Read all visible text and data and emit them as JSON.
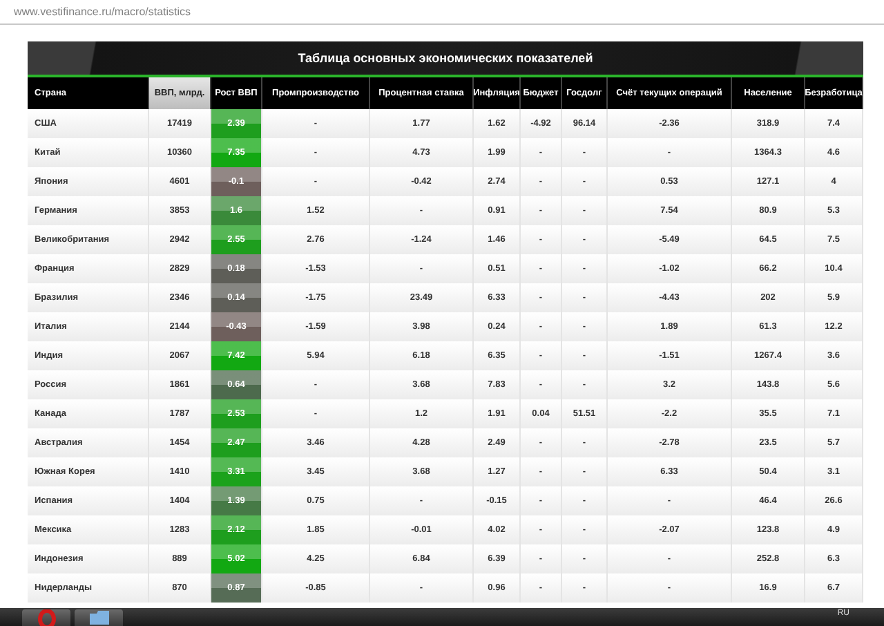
{
  "browser": {
    "url": "www.vestifinance.ru/macro/statistics"
  },
  "table": {
    "title": "Таблица основных экономических показателей",
    "columns": [
      {
        "label": "Страна",
        "selected": false
      },
      {
        "label": "ВВП, млрд.",
        "selected": true
      },
      {
        "label": "Рост ВВП",
        "selected": false
      },
      {
        "label": "Промпроизводство",
        "selected": false
      },
      {
        "label": "Процентная ставка",
        "selected": false
      },
      {
        "label": "Инфляция",
        "selected": false
      },
      {
        "label": "Бюджет",
        "selected": false
      },
      {
        "label": "Госдолг",
        "selected": false
      },
      {
        "label": "Счёт текущих операций",
        "selected": false
      },
      {
        "label": "Население",
        "selected": false
      },
      {
        "label": "Безработица",
        "selected": false
      }
    ],
    "rows": [
      {
        "color": "#1e9e1e",
        "cells": [
          "США",
          "17419",
          "2.39",
          "-",
          "1.77",
          "1.62",
          "-4.92",
          "96.14",
          "-2.36",
          "318.9",
          "7.4"
        ]
      },
      {
        "color": "#12a812",
        "cells": [
          "Китай",
          "10360",
          "7.35",
          "-",
          "4.73",
          "1.99",
          "-",
          "-",
          "-",
          "1364.3",
          "4.6"
        ]
      },
      {
        "color": "#6e5f5c",
        "cells": [
          "Япония",
          "4601",
          "-0.1",
          "-",
          "-0.42",
          "2.74",
          "-",
          "-",
          "0.53",
          "127.1",
          "4"
        ]
      },
      {
        "color": "#3a8a3a",
        "cells": [
          "Германия",
          "3853",
          "1.6",
          "1.52",
          "-",
          "0.91",
          "-",
          "-",
          "7.54",
          "80.9",
          "5.3"
        ]
      },
      {
        "color": "#1e9e1e",
        "cells": [
          "Великобритания",
          "2942",
          "2.55",
          "2.76",
          "-1.24",
          "1.46",
          "-",
          "-",
          "-5.49",
          "64.5",
          "7.5"
        ]
      },
      {
        "color": "#5e5e58",
        "cells": [
          "Франция",
          "2829",
          "0.18",
          "-1.53",
          "-",
          "0.51",
          "-",
          "-",
          "-1.02",
          "66.2",
          "10.4"
        ]
      },
      {
        "color": "#5e5e58",
        "cells": [
          "Бразилия",
          "2346",
          "0.14",
          "-1.75",
          "23.49",
          "6.33",
          "-",
          "-",
          "-4.43",
          "202",
          "5.9"
        ]
      },
      {
        "color": "#6e5f5c",
        "cells": [
          "Италия",
          "2144",
          "-0.43",
          "-1.59",
          "3.98",
          "0.24",
          "-",
          "-",
          "1.89",
          "61.3",
          "12.2"
        ]
      },
      {
        "color": "#12a812",
        "cells": [
          "Индия",
          "2067",
          "7.42",
          "5.94",
          "6.18",
          "6.35",
          "-",
          "-",
          "-1.51",
          "1267.4",
          "3.6"
        ]
      },
      {
        "color": "#4d6a4d",
        "cells": [
          "Россия",
          "1861",
          "0.64",
          "-",
          "3.68",
          "7.83",
          "-",
          "-",
          "3.2",
          "143.8",
          "5.6"
        ]
      },
      {
        "color": "#1e9e1e",
        "cells": [
          "Канада",
          "1787",
          "2.53",
          "-",
          "1.2",
          "1.91",
          "0.04",
          "51.51",
          "-2.2",
          "35.5",
          "7.1"
        ]
      },
      {
        "color": "#1e9e1e",
        "cells": [
          "Австралия",
          "1454",
          "2.47",
          "3.46",
          "4.28",
          "2.49",
          "-",
          "-",
          "-2.78",
          "23.5",
          "5.7"
        ]
      },
      {
        "color": "#1ba21b",
        "cells": [
          "Южная Корея",
          "1410",
          "3.31",
          "3.45",
          "3.68",
          "1.27",
          "-",
          "-",
          "6.33",
          "50.4",
          "3.1"
        ]
      },
      {
        "color": "#467a46",
        "cells": [
          "Испания",
          "1404",
          "1.39",
          "0.75",
          "-",
          "-0.15",
          "-",
          "-",
          "-",
          "46.4",
          "26.6"
        ]
      },
      {
        "color": "#1e9e1e",
        "cells": [
          "Мексика",
          "1283",
          "2.12",
          "1.85",
          "-0.01",
          "4.02",
          "-",
          "-",
          "-2.07",
          "123.8",
          "4.9"
        ]
      },
      {
        "color": "#12a812",
        "cells": [
          "Индонезия",
          "889",
          "5.02",
          "4.25",
          "6.84",
          "6.39",
          "-",
          "-",
          "-",
          "252.8",
          "6.3"
        ]
      },
      {
        "color": "#566c56",
        "cells": [
          "Нидерланды",
          "870",
          "0.87",
          "-0.85",
          "-",
          "0.96",
          "-",
          "-",
          "-",
          "16.9",
          "6.7"
        ]
      }
    ]
  },
  "taskbar": {
    "language": "RU"
  }
}
